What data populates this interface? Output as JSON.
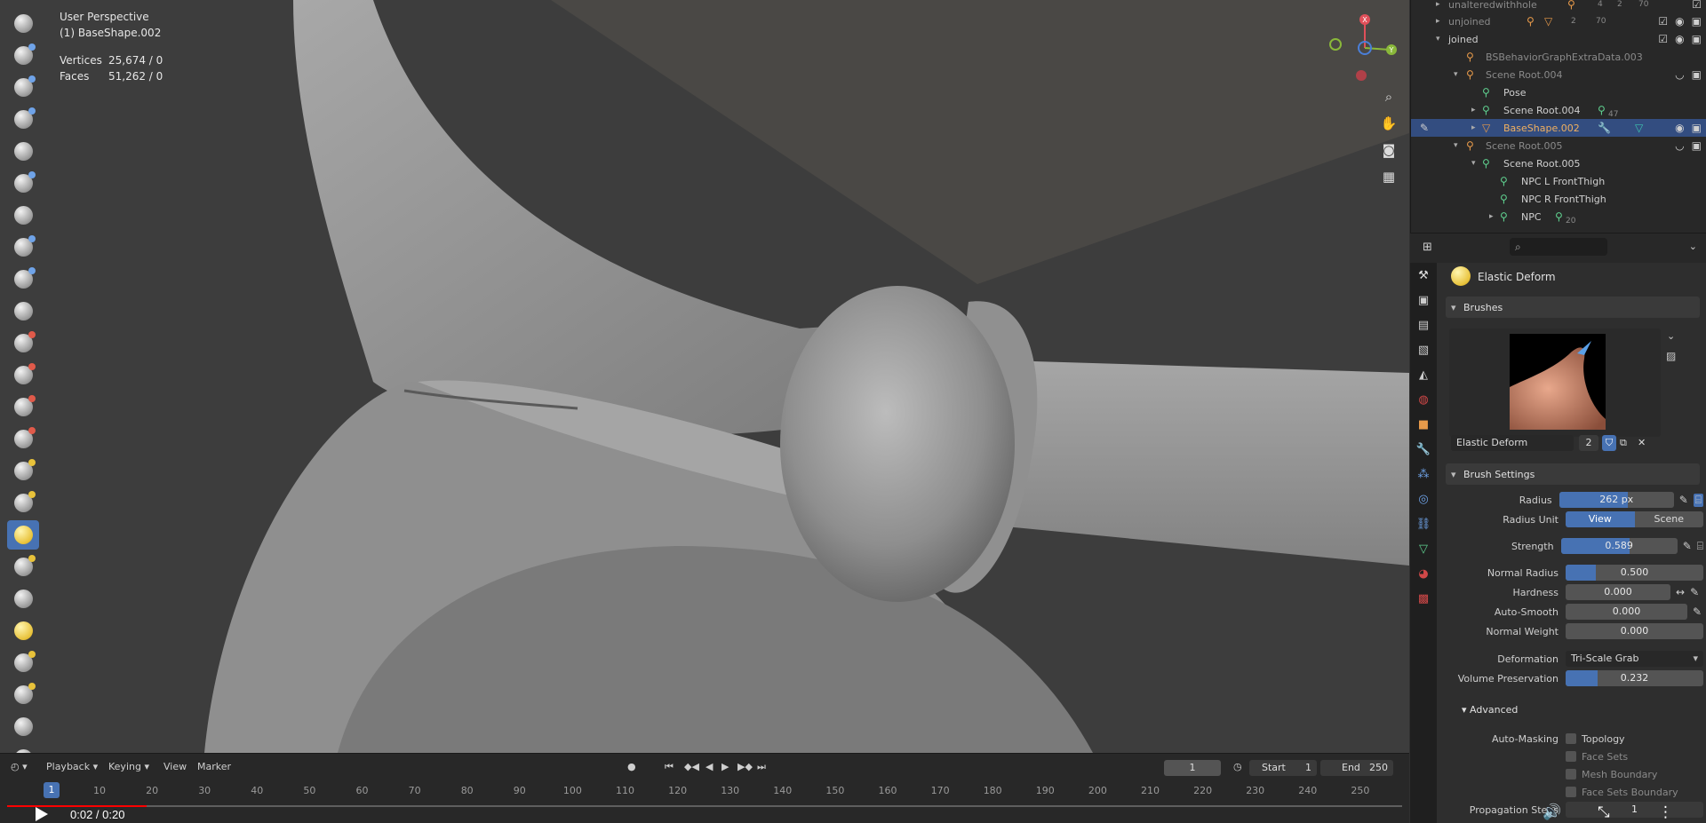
{
  "viewport": {
    "title": "User Perspective",
    "object": "(1) BaseShape.002",
    "stats": [
      {
        "label": "Vertices",
        "value": "25,674 / 0"
      },
      {
        "label": "Faces",
        "value": "51,262 / 0"
      }
    ],
    "gizmo": {
      "x": "X",
      "y": "Y"
    }
  },
  "outliner": {
    "rows": [
      {
        "name": "unalteredwithhole",
        "level": 0,
        "dim": true
      },
      {
        "name": "unjoined",
        "level": 0,
        "dim": true
      },
      {
        "name": "joined",
        "level": 0,
        "dim": false
      },
      {
        "name": "BSBehaviorGraphExtraData.003",
        "level": 1,
        "dim": true
      },
      {
        "name": "Scene Root.004",
        "level": 1,
        "dim": true
      },
      {
        "name": "Pose",
        "level": 2,
        "dim": false
      },
      {
        "name": "Scene Root.004",
        "level": 2,
        "dim": false
      },
      {
        "name": "BaseShape.002",
        "level": 2,
        "dim": false
      },
      {
        "name": "Scene Root.005",
        "level": 1,
        "dim": true
      },
      {
        "name": "Scene Root.005",
        "level": 2,
        "dim": false
      },
      {
        "name": "NPC L FrontThigh",
        "level": 3,
        "dim": false
      },
      {
        "name": "NPC R FrontThigh",
        "level": 3,
        "dim": false
      },
      {
        "name": "NPC",
        "level": 3,
        "dim": false
      }
    ],
    "badges": {
      "unaltered": [
        "4",
        "2",
        "70"
      ],
      "unjoined": [
        "2",
        "70"
      ],
      "scene_root_004": "47",
      "npc": "20"
    }
  },
  "properties": {
    "brush_name": "Elastic Deform",
    "sections": {
      "brushes": "Brushes",
      "brush_settings": "Brush Settings",
      "advanced": "Advanced"
    },
    "brush_field": {
      "name": "Elastic Deform",
      "users": "2"
    },
    "radius": {
      "label": "Radius",
      "value": "262 px",
      "fill": 0.6
    },
    "radius_unit": {
      "label": "Radius Unit",
      "options": [
        "View",
        "Scene"
      ],
      "selected": "View"
    },
    "strength": {
      "label": "Strength",
      "value": "0.589",
      "fill": 0.589
    },
    "normal_radius": {
      "label": "Normal Radius",
      "value": "0.500",
      "fill": 0.22
    },
    "hardness": {
      "label": "Hardness",
      "value": "0.000",
      "fill": 0
    },
    "auto_smooth": {
      "label": "Auto-Smooth",
      "value": "0.000",
      "fill": 0
    },
    "normal_weight": {
      "label": "Normal Weight",
      "value": "0.000",
      "fill": 0
    },
    "deformation": {
      "label": "Deformation",
      "value": "Tri-Scale Grab"
    },
    "volume_preservation": {
      "label": "Volume Preservation",
      "value": "0.232",
      "fill": 0.232
    },
    "auto_masking": {
      "label": "Auto-Masking",
      "options": [
        "Topology",
        "Face Sets",
        "Mesh Boundary",
        "Face Sets Boundary"
      ]
    },
    "propagation_steps": {
      "label": "Propagation Steps",
      "value": "1"
    }
  },
  "timeline": {
    "menus": [
      "Playback",
      "Keying",
      "View",
      "Marker"
    ],
    "current_frame": "1",
    "start_label": "Start",
    "start": "1",
    "end_label": "End",
    "end": "250",
    "ticks": [
      "10",
      "20",
      "30",
      "40",
      "50",
      "60",
      "70",
      "80",
      "90",
      "100",
      "110",
      "120",
      "130",
      "140",
      "150",
      "160",
      "170",
      "180",
      "190",
      "200",
      "210",
      "220",
      "230",
      "240",
      "250"
    ],
    "playhead": "1"
  },
  "video": {
    "time": "0:02 / 0:20",
    "progress": 0.1
  },
  "colors": {
    "accent": "#4772b3",
    "selected_row": "#334d80",
    "axis_x": "#e0505a",
    "axis_y": "#8ab83a",
    "axis_z": "#4a7fd8"
  }
}
